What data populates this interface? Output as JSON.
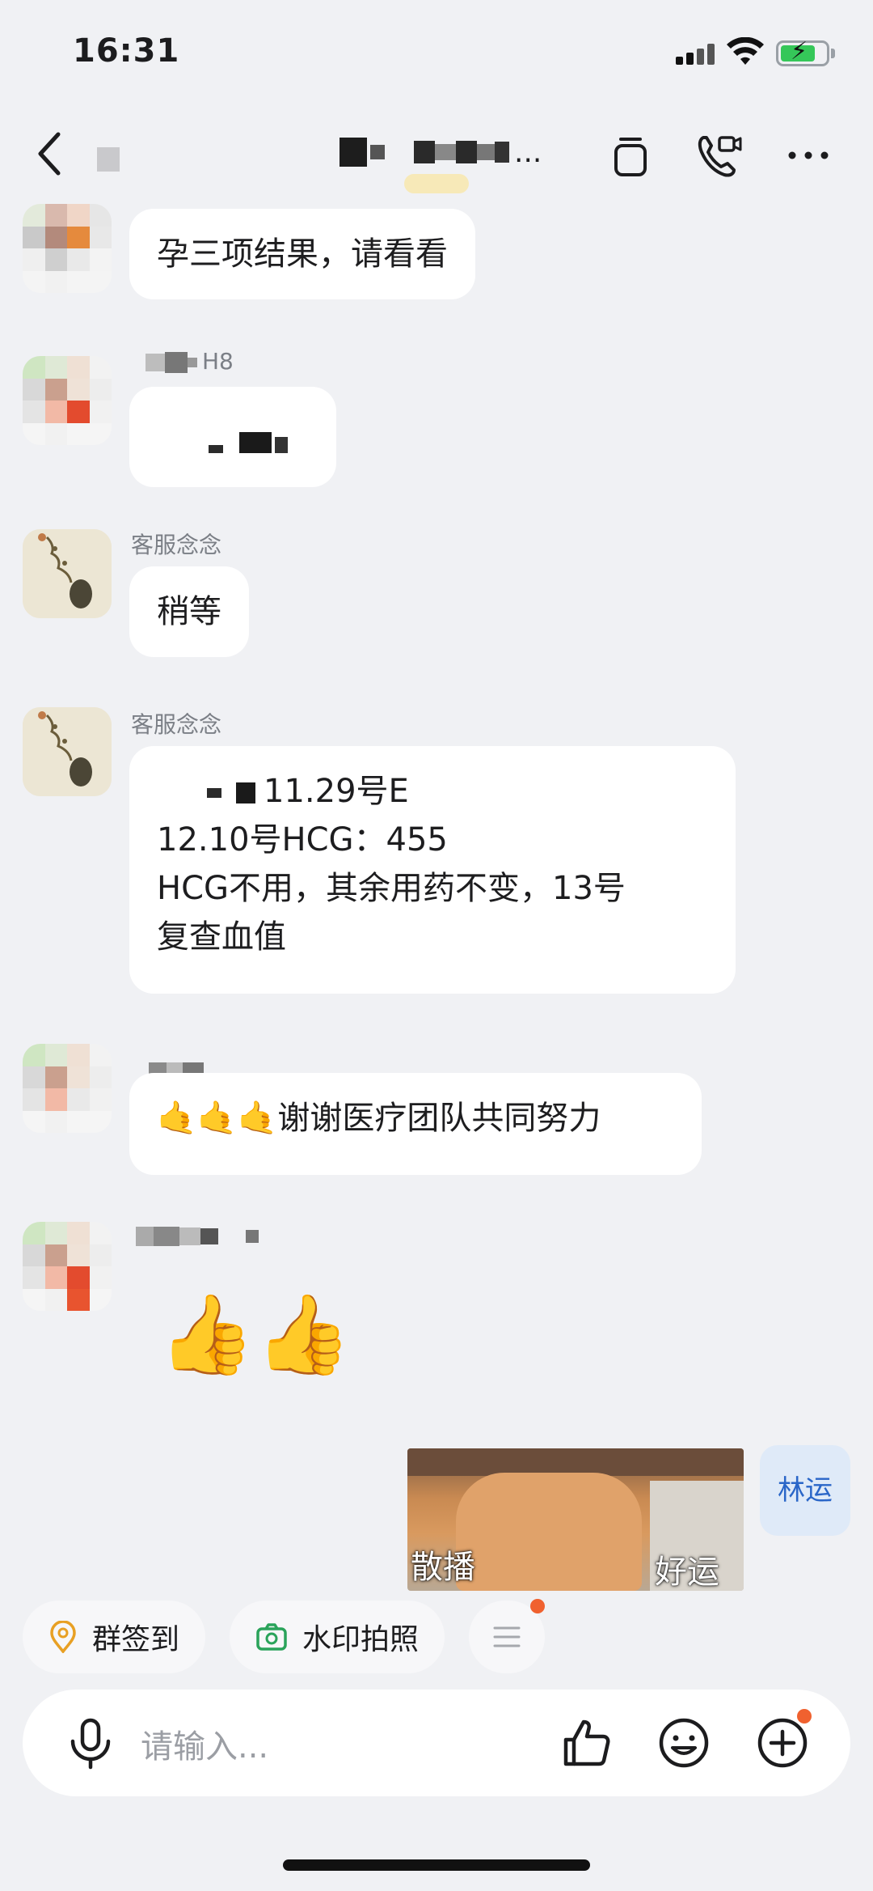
{
  "status_bar": {
    "time": "16:31",
    "battery_color": "#35c759"
  },
  "header": {
    "title_suffix": "...",
    "sub_badge": "",
    "back_icon": "chevron-left-icon",
    "icons": [
      "copy-icon",
      "video-call-icon",
      "more-icon"
    ]
  },
  "messages": [
    {
      "sender": "",
      "text_lines": [
        "孕三项结果，请看看"
      ]
    },
    {
      "sender": "H8",
      "text_lines": [
        ""
      ]
    },
    {
      "sender": "客服念念",
      "text_lines": [
        "稍等"
      ]
    },
    {
      "sender": "客服念念",
      "text_lines": [
        "11.29号E",
        "12.10号HCG：455",
        "HCG不用，其余用药不变，13号",
        "复查血值"
      ]
    },
    {
      "sender": "",
      "text_lines": [
        "谢谢医疗团队共同努力"
      ],
      "emoji": "🤙🤙🤙"
    },
    {
      "sender": "",
      "emoji": "👍👍"
    }
  ],
  "self_message": {
    "sticker_left": "散播",
    "sticker_right": "好运",
    "self_name": "林运"
  },
  "quick_actions": [
    {
      "label": "群签到",
      "icon": "location-icon"
    },
    {
      "label": "水印拍照",
      "icon": "camera-icon"
    }
  ],
  "input": {
    "placeholder": "请输入..."
  },
  "colors": {
    "accent_orange": "#f0612f",
    "accent_green": "#2aa35a",
    "self_blue": "#2a66c8"
  }
}
